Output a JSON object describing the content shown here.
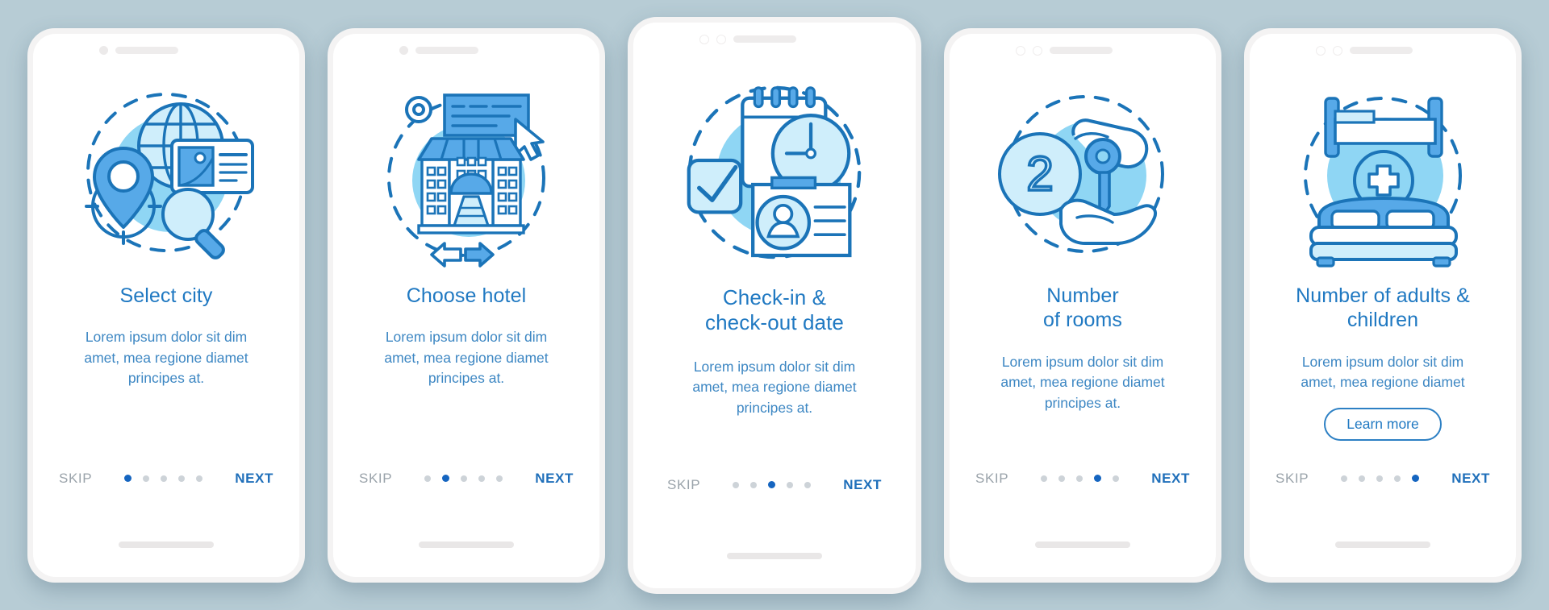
{
  "palette": {
    "background": "#b7ccd5",
    "phone_frame": "#f4f3f3",
    "screen": "#ffffff",
    "title_blue": "#2079c2",
    "body_blue": "#3d87c3",
    "accent_blue": "#1565c0",
    "line_blue": "#1b74b8",
    "fill_mid_blue": "#57a9e8",
    "fill_light_blue": "#8fd6f4",
    "fill_pale_blue": "#cfeefb",
    "skip_gray": "#9aa3aa",
    "dot_inactive": "#cdd3d8"
  },
  "screens": [
    {
      "id": "select-city",
      "title": "Select city",
      "body": "Lorem ipsum dolor sit dim\namet, mea regione diamet\nprincipes at.",
      "skip_label": "SKIP",
      "next_label": "NEXT",
      "dots_total": 5,
      "active_dot": 1,
      "learn_more_label": null,
      "icon": "globe-location-card-search-icon",
      "statusbar": "single-dot"
    },
    {
      "id": "choose-hotel",
      "title": "Choose hotel",
      "body": "Lorem ipsum dolor sit dim\namet, mea regione diamet\nprincipes at.",
      "skip_label": "SKIP",
      "next_label": "NEXT",
      "dots_total": 5,
      "active_dot": 2,
      "learn_more_label": null,
      "icon": "hotel-building-cursor-icon",
      "statusbar": "single-dot"
    },
    {
      "id": "check-in-out-date",
      "title": "Check-in &\ncheck-out date",
      "body": "Lorem ipsum dolor sit dim\namet, mea regione diamet\nprincipes at.",
      "skip_label": "SKIP",
      "next_label": "NEXT",
      "dots_total": 5,
      "active_dot": 3,
      "learn_more_label": null,
      "icon": "calendar-clock-idcard-icon",
      "statusbar": "double-ring"
    },
    {
      "id": "number-of-rooms",
      "title": "Number\nof rooms",
      "body": "Lorem ipsum dolor sit dim\namet, mea regione diamet\nprincipes at.",
      "skip_label": "SKIP",
      "next_label": "NEXT",
      "dots_total": 5,
      "active_dot": 4,
      "learn_more_label": null,
      "icon": "key-handover-two-icon",
      "statusbar": "double-ring"
    },
    {
      "id": "number-of-adults-children",
      "title": "Number of adults &\nchildren",
      "body": "Lorem ipsum dolor sit dim\namet, mea regione diamet",
      "skip_label": "SKIP",
      "next_label": "NEXT",
      "dots_total": 5,
      "active_dot": 5,
      "learn_more_label": "Learn more",
      "icon": "bed-plus-icon",
      "statusbar": "double-ring"
    }
  ]
}
